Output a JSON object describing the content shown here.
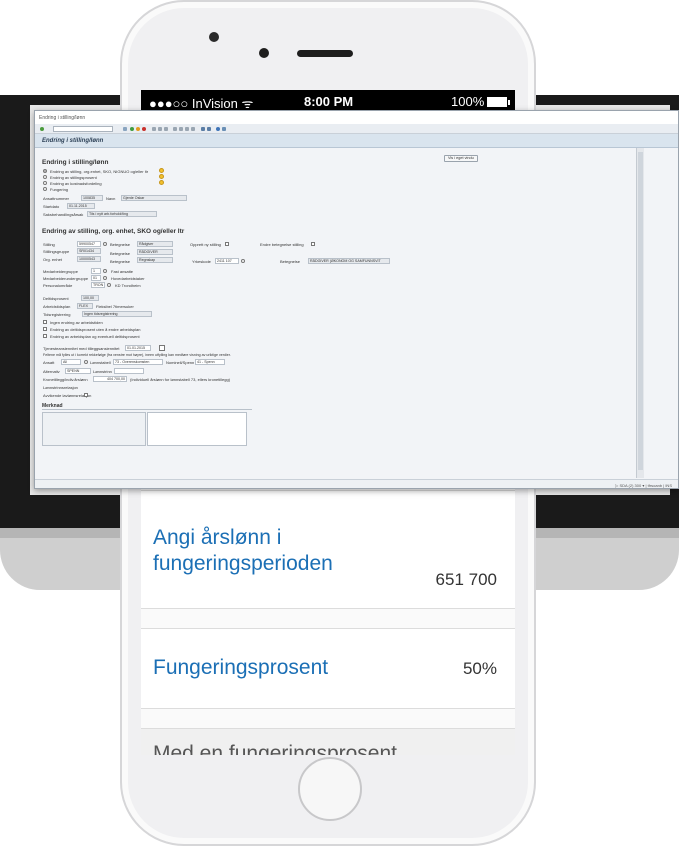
{
  "status_bar": {
    "carrier": "●●●○○ InVision ᯤ",
    "time": "8:00 PM",
    "battery": "100%"
  },
  "mobile": {
    "rows": [
      {
        "label": "Angi årslønn i fungeringsperioden",
        "value": "651 700"
      },
      {
        "label": "Fungeringsprosent",
        "value": "50%"
      },
      {
        "label": "Med en fungeringsprosent",
        "value": ""
      }
    ]
  },
  "sap": {
    "window_title": "Endring i stilling/lønn",
    "header_title": "Endring i stilling/lønn",
    "action_button": "Vis i eget vindu",
    "section1": {
      "title": "Endring i stilling/lønn",
      "options": [
        "Endring av stilling, org.enhet, SKO, NIGNUO og/eller ltr",
        "Endring av stillingsprosent",
        "Endring av kostnadsfordeling",
        "Fungering"
      ],
      "ansattnummer_label": "Ansattnummer",
      "ansattnummer": "100835",
      "navn_label": "Navn",
      "navn": "Gjerde Oskar",
      "startdato_label": "Startdato",
      "startdato": "01.11.2015",
      "saksbehandling_label": "Saksbehandlingsårsak",
      "saksbehandling": "Tils i nytt arb.forhold/ting"
    },
    "section2": {
      "title": "Endring av stilling, org. enhet, SKO og/eller ltr",
      "stilling_label": "Stilling",
      "stilling": "59900547",
      "stilling_betegnelse_label": "Betegnelse",
      "stilling_betegnelse": "Rådgiver",
      "opprett_label": "Opprett ny stilling",
      "endre_label": "Endre betegnelse stilling",
      "stillingsgruppe_label": "Stillingsgruppe",
      "stillingsgruppe": "SR01434",
      "stillingsgruppe_betegnelse_label": "Betegnelse",
      "stillingsgruppe_betegnelse": "RÅDGIVER",
      "org_label": "Org. enhet",
      "org": "10000543",
      "org_betegnelse_label": "Betegnelse",
      "org_betegnelse": "Regnskap",
      "yrkeskode_label": "Yrkeskode",
      "yrkeskode": "2411 107",
      "yrkeskode_betegnelse_label": "Betegnelse",
      "yrkeskode_betegnelse": "RÅDGIVER (ØKONOM OG SAMFUNNSVIT",
      "ansattgruppe_label": "Medarbeidergruppe",
      "ansattgruppe": "1",
      "ansattgruppe_text": "Fast ansatte",
      "ansattundergruppe_label": "Medarbeiderundergruppe",
      "ansattundergruppe": "01",
      "ansattundergruppe_text": "Hovedarbeidstaker",
      "personalomrade_label": "Personalområde",
      "personalomrade": "TRON",
      "personalomrade_text": "KD Trondheim",
      "deltid_label": "Deltidsprosent",
      "deltid": "100,00",
      "arbeidstid_label": "Arbeidstidsplan",
      "arbeidstid": "FLEX",
      "arbeidstid_text": "Fleksibel 7timersuker",
      "tidsreg_label": "Tidsregistrering",
      "tidsreg": "Ingen tidsregistrering",
      "checkboxes": [
        "Ingen endring av arbeidstiden",
        "Endring av deltidsprosent uten å endre arbeidsplan",
        "Endring av arbeidsplan og eventuell deltidsprosent"
      ],
      "tjeneste_label": "Tjenesteansiennitet med tilleggsansiennitet",
      "tjeneste": "01.01.2015",
      "note": "Feltene må fylles ut i korrekt rekkefølge (fra venstre mot høyre), ineen utfylling kan medføre visning av uriktige verdier.",
      "ansatt_label": "Ansatt",
      "ansatt": "All",
      "lonnstabell_label": "Lønnstabell",
      "lonnstabell": "73 - Overenskomsten",
      "nominell_label": "Nominell/Spenn",
      "nominell": "41 - Spenn",
      "alternativ_label": "Alternativ",
      "alternativ": "SPENN",
      "lonnstrinn_label": "Lønnstrinn",
      "kronetillegg_label": "Kronetillegg/indiv.årslønn",
      "kronetillegg": "404 700,00",
      "kronetillegg_text": "(Individuell årslønn for lønnstabell 73, ellers kronetillegg)",
      "lonnstrinnrelasjon_label": "Lønnstrinnsrelasjon",
      "avvikende_label": "Avvikende lavlønnsrelasjon"
    },
    "merknad_title": "Merknad",
    "status_text": "▷ SDA (2) 300 ▾ | tfrsoanb | INS"
  }
}
